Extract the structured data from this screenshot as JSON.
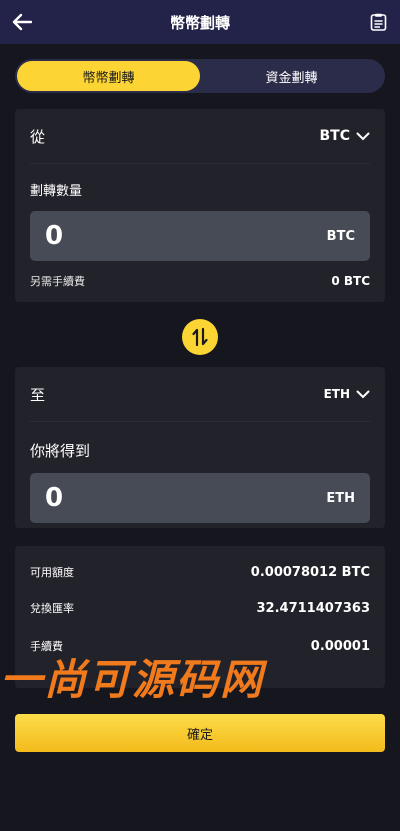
{
  "header": {
    "title": "幣幣劃轉"
  },
  "tabs": [
    {
      "label": "幣幣劃轉",
      "active": true
    },
    {
      "label": "資金劃轉",
      "active": false
    }
  ],
  "from": {
    "label": "從",
    "coin": "BTC",
    "amount_label": "劃轉數量",
    "amount_value": "0",
    "amount_unit": "BTC",
    "fee_label": "另需手續費",
    "fee_value": "0 BTC"
  },
  "to": {
    "label": "至",
    "coin": "ETH",
    "receive_label": "你將得到",
    "receive_value": "0",
    "receive_unit": "ETH"
  },
  "info": {
    "available_label": "可用額度",
    "available_value": "0.00078012 BTC",
    "rate_label": "兌換匯率",
    "rate_value": "32.4711407363",
    "fee_label": "手續費",
    "fee_value": "0.00001"
  },
  "watermark": "一尚可源码网",
  "confirm_label": "確定",
  "colors": {
    "accent": "#fcd535",
    "header_bg": "#23234a",
    "card_bg": "#22222a",
    "watermark": "#f07a1c"
  }
}
